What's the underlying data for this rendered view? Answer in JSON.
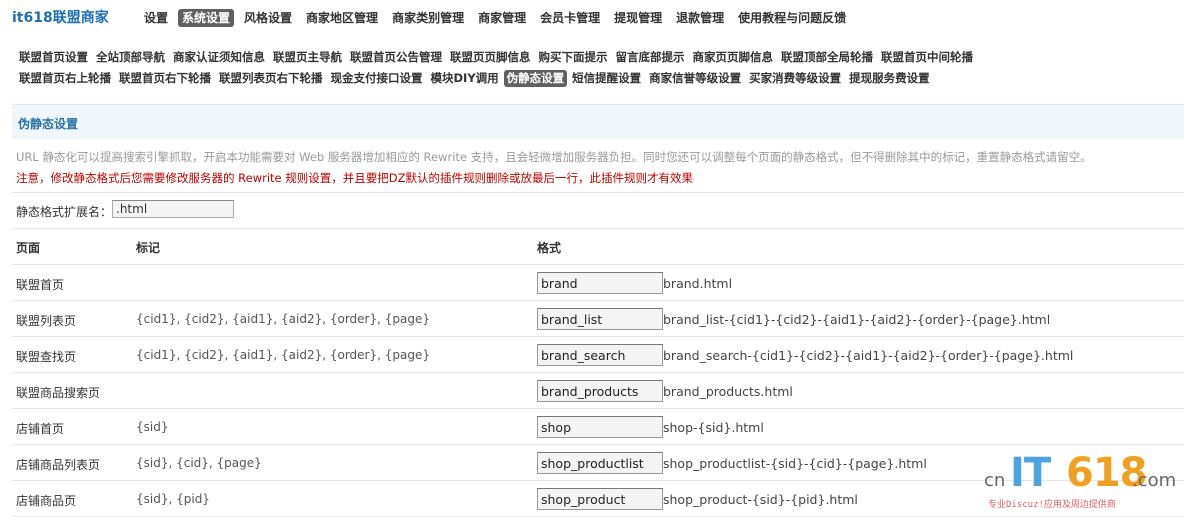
{
  "app": {
    "title": "it618联盟商家"
  },
  "topnav": [
    {
      "label": "设置",
      "active": false
    },
    {
      "label": "系统设置",
      "active": true
    },
    {
      "label": "风格设置",
      "active": false
    },
    {
      "label": "商家地区管理",
      "active": false
    },
    {
      "label": "商家类别管理",
      "active": false
    },
    {
      "label": "商家管理",
      "active": false
    },
    {
      "label": "会员卡管理",
      "active": false
    },
    {
      "label": "提现管理",
      "active": false
    },
    {
      "label": "退款管理",
      "active": false
    },
    {
      "label": "使用教程与问题反馈",
      "active": false
    }
  ],
  "subnav": {
    "row1": [
      "联盟首页设置",
      "全站顶部导航",
      "商家认证须知信息",
      "联盟页主导航",
      "联盟首页公告管理",
      "联盟页页脚信息",
      "购买下面提示",
      "留言底部提示",
      "商家页页脚信息",
      "联盟顶部全局轮播",
      "联盟首页中间轮播"
    ],
    "row2": [
      "联盟首页右上轮播",
      "联盟首页右下轮播",
      "联盟列表页右下轮播",
      "现金支付接口设置",
      "模块DIY调用",
      "伪静态设置",
      "短信提醒设置",
      "商家信誉等级设置",
      "买家消费等级设置",
      "提现服务费设置"
    ],
    "active": "伪静态设置"
  },
  "panel": {
    "title": "伪静态设置",
    "tip_gray": "URL 静态化可以提高搜索引擎抓取，开启本功能需要对 Web 服务器增加相应的 Rewrite 支持，且会轻微增加服务器负担。同时您还可以调整每个页面的静态格式，但不得删除其中的标记，重置静态格式请留空。",
    "tip_red": "注意，修改静态格式后您需要修改服务器的 Rewrite 规则设置，并且要把DZ默认的插件规则删除或放最后一行，此插件规则才有效果",
    "ext_label": "静态格式扩展名：",
    "ext_value": ".html"
  },
  "table": {
    "headers": {
      "page": "页面",
      "mark": "标记",
      "format": "格式"
    },
    "rows": [
      {
        "page": "联盟首页",
        "mark": "",
        "value": "brand",
        "preview": "brand.html"
      },
      {
        "page": "联盟列表页",
        "mark": "{cid1}, {cid2}, {aid1}, {aid2}, {order}, {page}",
        "value": "brand_list",
        "preview": "brand_list-{cid1}-{cid2}-{aid1}-{aid2}-{order}-{page}.html"
      },
      {
        "page": "联盟查找页",
        "mark": "{cid1}, {cid2}, {aid1}, {aid2}, {order}, {page}",
        "value": "brand_search",
        "preview": "brand_search-{cid1}-{cid2}-{aid1}-{aid2}-{order}-{page}.html"
      },
      {
        "page": "联盟商品搜索页",
        "mark": "",
        "value": "brand_products",
        "preview": "brand_products.html"
      },
      {
        "page": "店铺首页",
        "mark": "{sid}",
        "value": "shop",
        "preview": "shop-{sid}.html"
      },
      {
        "page": "店铺商品列表页",
        "mark": "{sid}, {cid}, {page}",
        "value": "shop_productlist",
        "preview": "shop_productlist-{sid}-{cid}-{page}.html"
      },
      {
        "page": "店铺商品页",
        "mark": "{sid}, {pid}",
        "value": "shop_product",
        "preview": "shop_product-{sid}-{pid}.html"
      }
    ]
  },
  "watermark": {
    "cn": "cn",
    "it": "IT",
    "num": "618",
    "com": ".com",
    "slogan": "专业Discuz!应用及周边提供商",
    "colors": {
      "it": "#4da3e0",
      "num": "#f0a020",
      "slogan": "#e06060"
    }
  }
}
